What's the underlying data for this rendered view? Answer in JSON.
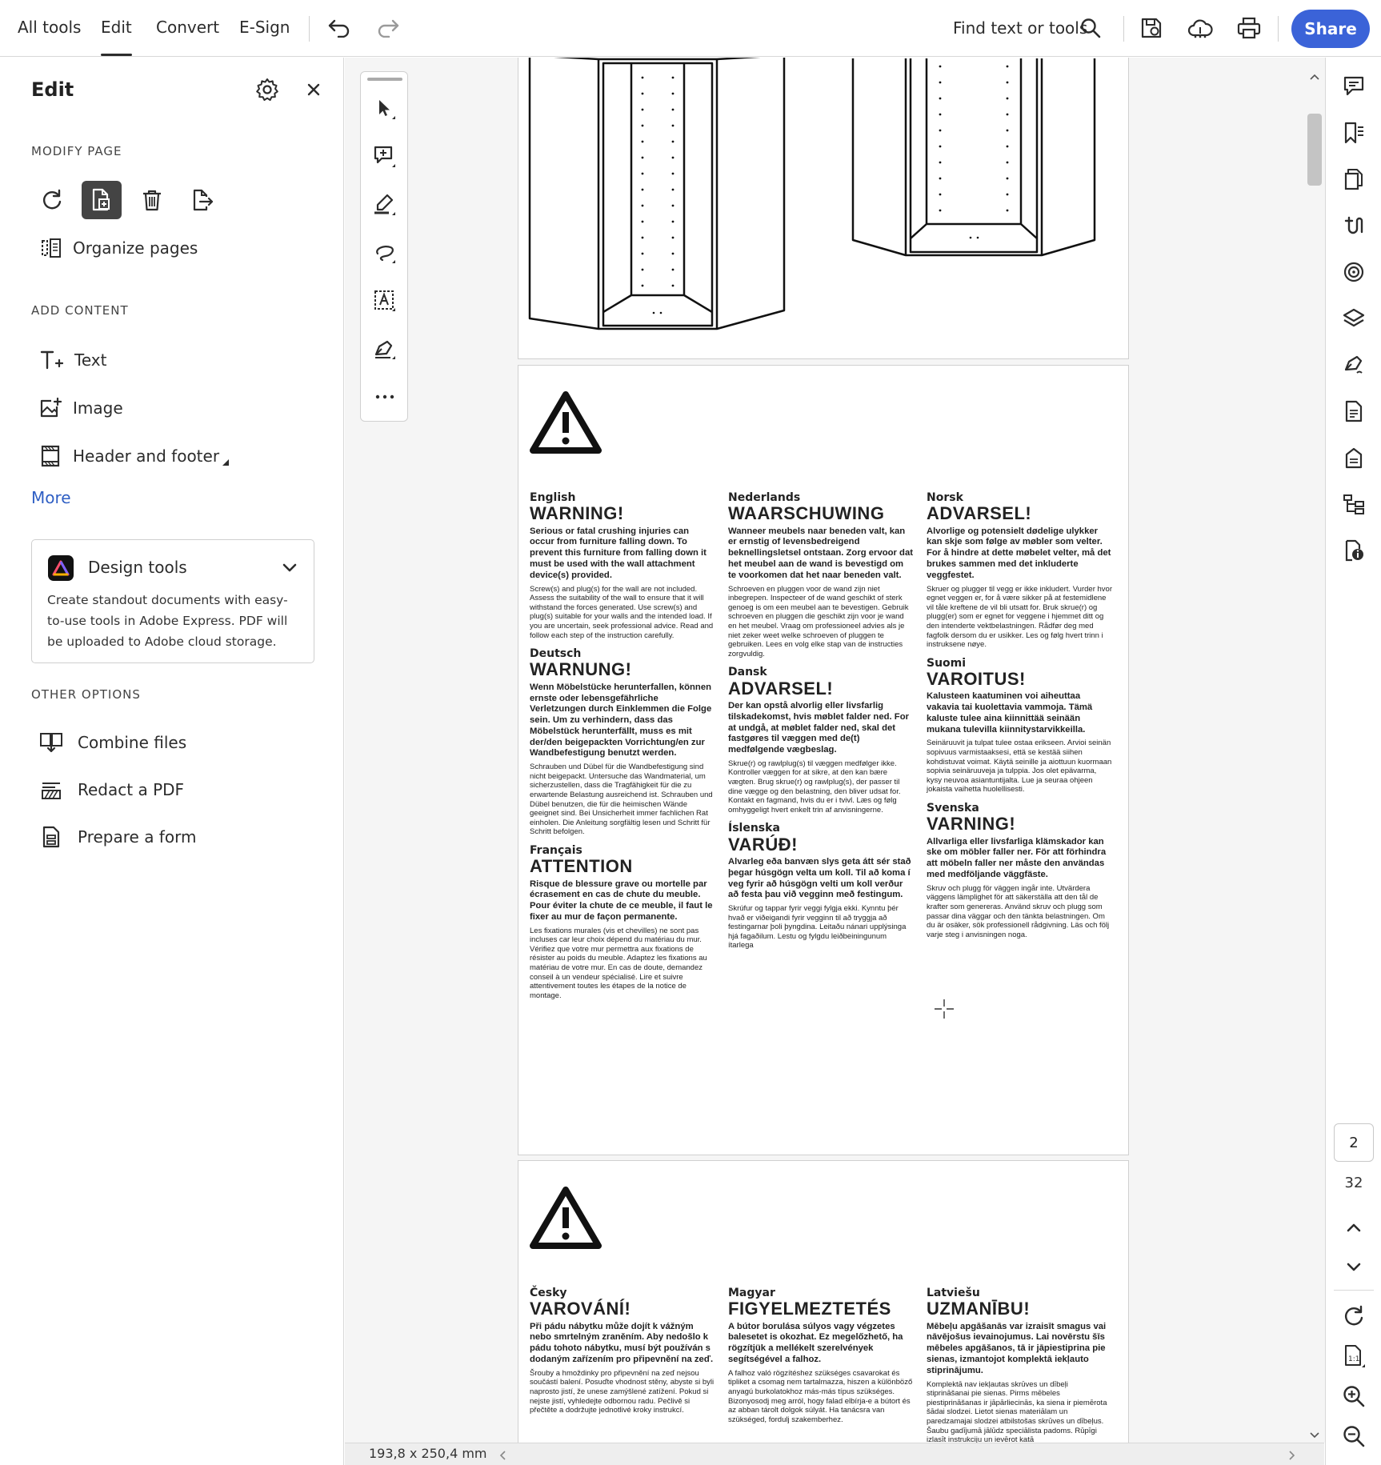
{
  "topbar": {
    "nav": [
      "All tools",
      "Edit",
      "Convert",
      "E-Sign"
    ],
    "active_nav": "Edit",
    "find_placeholder": "Find text or tools",
    "share_label": "Share"
  },
  "left_panel": {
    "title": "Edit",
    "modify_page": {
      "heading": "MODIFY PAGE",
      "organize_label": "Organize pages"
    },
    "add_content": {
      "heading": "ADD CONTENT",
      "items": [
        "Text",
        "Image",
        "Header and footer"
      ],
      "more_label": "More"
    },
    "design_tools": {
      "title": "Design tools",
      "description": "Create standout documents with easy-to-use tools in Adobe Express. PDF will be uploaded to Adobe cloud storage."
    },
    "other_options": {
      "heading": "OTHER OPTIONS",
      "items": [
        "Combine files",
        "Redact a PDF",
        "Prepare a form"
      ]
    }
  },
  "document": {
    "page2_warnings": [
      [
        {
          "lang": "English",
          "title": "WARNING!",
          "bold": "Serious or fatal crushing injuries can occur from furniture falling down. To prevent this furniture from falling down it must be used with the wall attachment device(s) provided.",
          "text": "Screw(s) and plug(s) for the wall are not included. Assess the suitability of the wall to ensure that it will withstand the forces generated. Use screw(s) and plug(s) suitable for your walls and the intended load. If you are uncertain, seek professional advice. Read and follow each step of the instruction carefully."
        },
        {
          "lang": "Deutsch",
          "title": "WARNUNG!",
          "bold": "Wenn Möbelstücke herunterfallen, können ernste oder lebensgefährliche Verletzungen durch Einklemmen die Folge sein. Um zu verhindern, dass das Möbelstück herunterfällt, muss es mit der/den beigepackten Vorrichtung/en zur Wandbefestigung benutzt werden.",
          "text": "Schrauben und Dübel für die Wandbefestigung sind nicht beigepackt. Untersuche das Wandmaterial, um sicherzustellen, dass die Tragfähigkeit für die zu erwartende Belastung ausreichend ist. Schrauben und Dübel benutzen, die für die heimischen Wände geeignet sind. Bei Unsicherheit immer fachlichen Rat einholen. Die Anleitung sorgfältig lesen und Schritt für Schritt befolgen."
        },
        {
          "lang": "Français",
          "title": "ATTENTION",
          "bold": "Risque de blessure grave ou mortelle par écrasement en cas de chute du meuble. Pour éviter la chute de ce meuble, il faut le fixer au mur de façon permanente.",
          "text": "Les fixations murales (vis et chevilles) ne sont pas incluses car leur choix dépend du matériau du mur. Vérifiez que votre mur permettra aux fixations de résister au poids du meuble. Adaptez les fixations au matériau de votre mur. En cas de doute, demandez conseil à un vendeur spécialisé. Lire et suivre attentivement toutes les étapes de la notice de montage."
        }
      ],
      [
        {
          "lang": "Nederlands",
          "title": "WAARSCHUWING",
          "bold": "Wanneer meubels naar beneden valt, kan er ernstig of levensbedreigend beknellingsletsel ontstaan. Zorg ervoor dat het meubel aan de wand is bevestigd om te voorkomen dat het naar beneden valt.",
          "text": "Schroeven en pluggen voor de wand zijn niet inbegrepen. Inspecteer of de wand geschikt of sterk genoeg is om een meubel aan te bevestigen. Gebruik schroeven en pluggen die geschikt zijn voor je wand en het meubel. Vraag om professioneel advies als je niet zeker weet welke schroeven of pluggen te gebruiken. Lees en volg elke stap van de instructies zorgvuldig."
        },
        {
          "lang": "Dansk",
          "title": "ADVARSEL!",
          "bold": "Der kan opstå alvorlig eller livsfarlig tilskadekomst, hvis møblet falder ned. For at undgå, at møblet falder ned, skal det fastgøres til væggen med de(t) medfølgende vægbeslag.",
          "text": "Skrue(r) og rawlplug(s) til væggen medfølger ikke. Kontroller væggen for at sikre, at den kan bære vægten. Brug skrue(r) og rawlplug(s), der passer til dine vægge og den belastning, den bliver udsat for. Kontakt en fagmand, hvis du er i tvivl. Læs og følg omhyggeligt hvert enkelt trin af anvisningerne."
        },
        {
          "lang": "Íslenska",
          "title": "VARÚÐ!",
          "bold": "Alvarleg eða banvæn slys geta átt sér stað þegar húsgögn velta um koll. Til að koma í veg fyrir að húsgögn velti um koll verður að festa þau við vegginn með festingum.",
          "text": "Skrúfur og tappar fyrir veggi fylgja ekki. Kynntu þér hvað er viðeigandi fyrir vegginn til að tryggja að festingarnar þoli þyngdina. Leitaðu nánari upplýsinga hjá fagaðilum. Lestu og fylgdu leiðbeiningunum ítarlega"
        }
      ],
      [
        {
          "lang": "Norsk",
          "title": "ADVARSEL!",
          "bold": "Alvorlige og potensielt dødelige ulykker kan skje som følge av møbler som velter. For å hindre at dette møbelet velter, må det brukes sammen med det inkluderte veggfestet.",
          "text": "Skruer og plugger til vegg er ikke inkludert. Vurder hvor egnet veggen er, for å være sikker på at festemidlene vil tåle kreftene de vil bli utsatt for. Bruk skrue(r) og plugg(er) som er egnet for veggene i hjemmet ditt og den intenderte vektbelastningen. Rådfør deg med fagfolk dersom du er usikker. Les og følg hvert trinn i instruksene nøye."
        },
        {
          "lang": "Suomi",
          "title": "VAROITUS!",
          "bold": "Kalusteen kaatuminen voi aiheuttaa vakavia tai kuolettavia vammoja. Tämä kaluste tulee aina kiinnittää seinään mukana tulevilla kiinnitystarvikkeilla.",
          "text": "Seinäruuvit ja tulpat tulee ostaa erikseen. Arvioi seinän sopivuus varmistaaksesi, että se kestää siihen kohdistuvat voimat. Käytä seinille ja aiottuun kuormaan sopivia seinäruuveja ja tulppia. Jos olet epävarma, kysy neuvoa asiantuntijalta. Lue ja seuraa ohjeen jokaista vaihetta huolellisesti."
        },
        {
          "lang": "Svenska",
          "title": "VARNING!",
          "bold": "Allvarliga eller livsfarliga klämskador kan ske om möbler faller ner. För att förhindra att möbeln faller ner måste den användas med medföljande väggfäste.",
          "text": "Skruv och plugg för väggen ingår inte. Utvärdera väggens lämplighet för att säkerställa att den tål de krafter som genereras. Använd skruv och plugg som passar dina väggar och den tänkta belastningen. Om du är osäker, sök professionell rådgivning. Läs och följ varje steg i anvisningen noga."
        }
      ]
    ],
    "page3_warnings": [
      {
        "lang": "Česky",
        "title": "VAROVÁNÍ!",
        "bold": "Při pádu nábytku může dojít k vážným nebo smrtelným zraněním. Aby nedošlo k pádu tohoto nábytku, musí být používán s dodaným zařízením pro připevnění na zeď.",
        "text": "Šrouby a hmoždinky pro připevnění na zeď nejsou součástí balení. Posuďte vhodnost stěny, abyste si byli naprosto jistí, že unese zamýšlené zatížení. Pokud si nejste jistí, vyhledejte odbornou radu. Pečlivě si přečtěte a dodržujte jednotlivé kroky instrukcí."
      },
      {
        "lang": "Magyar",
        "title": "FIGYELMEZTETÉS",
        "bold": "A bútor borulása súlyos vagy végzetes balesetet is okozhat. Ez megelőzhető, ha rögzítjük a mellékelt szerelvények segítségével a falhoz.",
        "text": "A falhoz való rögzítéshez szükséges csavarokat és tipliket a csomag nem tartalmazza, hiszen a különböző anyagú burkolatokhoz más-más típus szükséges. Bizonyosodj meg arról, hogy falad elbírja-e a bútort és az abban tárolt dolgok súlyát. Ha tanácsra van szükséged, fordulj szakemberhez."
      },
      {
        "lang": "Latviešu",
        "title": "UZMANĪBU!",
        "bold": "Mēbeļu apgāšanās var izraisīt smagus vai nāvējošus ievainojumus. Lai novērstu šīs mēbeles apgāšanos, tā ir jāpiestiprina pie sienas, izmantojot komplektā iekļauto stiprinājumu.",
        "text": "Komplektā nav iekļautas skrūves un dībeļi stiprināšanai pie sienas. Pirms mēbeles piestiprināšanas ir jāpārliecinās, ka siena ir piemērota šādai slodzei. Lietot sienas materiālam un paredzamajai slodzei atbilstošas skrūves un dībeļus. Šaubu gadījumā jālūdz speciālista padoms. Rūpīgi izlasīt instrukciju un ievērot katā"
      }
    ]
  },
  "right_rail": {
    "current_page": "2",
    "total_pages": "32"
  },
  "status": {
    "page_size": "193,8 x 250,4 mm"
  },
  "colors": {
    "accent": "#3b63d8",
    "selected_tool": "#444444"
  }
}
